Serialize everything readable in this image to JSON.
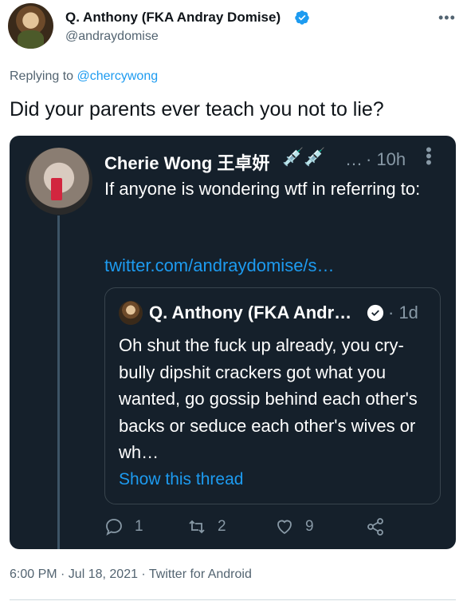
{
  "author": {
    "name": "Q. Anthony (FKA Andray Domise)",
    "handle": "@andraydomise"
  },
  "replying": {
    "prefix": "Replying to",
    "mention": "@chercywong"
  },
  "tweet_text": "Did your parents ever teach you not to lie?",
  "screenshot": {
    "name": "Cherie Wong 王卓妍",
    "emoji": "💉💉",
    "ellipsis": "…",
    "time": "· 10h",
    "text": "If anyone is wondering wtf in referring to:",
    "link": "twitter.com/andraydomise/s…",
    "quoted": {
      "name": "Q. Anthony (FKA Andr…",
      "time": "· 1d",
      "text": "Oh shut the fuck up already, you cry-bully dipshit crackers got what you wanted, go gossip behind each other's backs or seduce each other's wives or wh…",
      "show_thread": "Show this thread"
    },
    "reply_count": "1",
    "retweet_count": "2",
    "like_count": "9"
  },
  "meta": "6:00 PM · Jul 18, 2021 · Twitter for Android",
  "colors": {
    "accent": "#1d9bf0",
    "card_bg": "#15202b",
    "muted": "#536471"
  }
}
